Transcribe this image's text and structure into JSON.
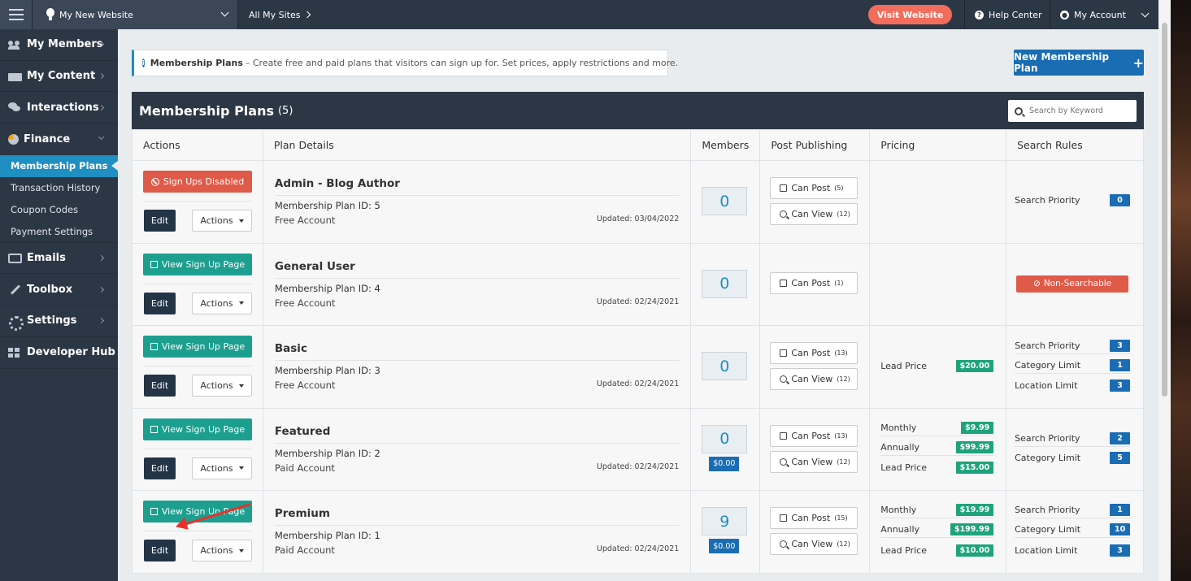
{
  "topbar": {
    "site_name": "My New Website",
    "all_sites": "All My Sites",
    "visit": "Visit Website",
    "help": "Help Center",
    "account": "My Account"
  },
  "sidebar": {
    "items": [
      {
        "label": "My Members",
        "icon": "members-icon"
      },
      {
        "label": "My Content",
        "icon": "folder-icon"
      },
      {
        "label": "Interactions",
        "icon": "chat-icon"
      },
      {
        "label": "Finance",
        "icon": "pie-chart-icon"
      }
    ],
    "finance_sub": [
      "Membership Plans",
      "Transaction History",
      "Coupon Codes",
      "Payment Settings"
    ],
    "items2": [
      {
        "label": "Emails",
        "icon": "inbox-icon"
      },
      {
        "label": "Toolbox",
        "icon": "wrench-icon"
      },
      {
        "label": "Settings",
        "icon": "gear-icon"
      },
      {
        "label": "Developer Hub",
        "icon": "grid-icon"
      }
    ]
  },
  "info": {
    "title": "Membership Plans",
    "text": "– Create free and paid plans that visitors can sign up for. Set prices, apply restrictions and more."
  },
  "new_plan": "New Membership Plan",
  "panel": {
    "title": "Membership Plans",
    "count": "(5)",
    "search_placeholder": "Search by Keyword"
  },
  "columns": [
    "Actions",
    "Plan Details",
    "Members",
    "Post Publishing",
    "Pricing",
    "Search Rules"
  ],
  "edit": "Edit",
  "actions": "Actions",
  "can_post": "Can Post",
  "can_view": "Can View",
  "plans": [
    {
      "action": "Sign Ups Disabled",
      "name": "Admin - Blog Author",
      "id_label": "Membership Plan ID:",
      "id": "5",
      "account": "Free Account",
      "updated": "Updated: 03/04/2022",
      "members": "0",
      "post_count": "(5)",
      "view_count": "(12)",
      "search": [
        {
          "label": "Search Priority",
          "value": "0"
        }
      ]
    },
    {
      "action": "View Sign Up Page",
      "name": "General User",
      "id_label": "Membership Plan ID:",
      "id": "4",
      "account": "Free Account",
      "updated": "Updated: 02/24/2021",
      "members": "0",
      "post_count": "(1)",
      "non_search": "Non-Searchable"
    },
    {
      "action": "View Sign Up Page",
      "name": "Basic",
      "id_label": "Membership Plan ID:",
      "id": "3",
      "account": "Free Account",
      "updated": "Updated: 02/24/2021",
      "members": "0",
      "post_count": "(13)",
      "view_count": "(12)",
      "pricing": [
        {
          "label": "Lead Price",
          "value": "$20.00"
        }
      ],
      "search": [
        {
          "label": "Search Priority",
          "value": "3"
        },
        {
          "label": "Category Limit",
          "value": "1"
        },
        {
          "label": "Location Limit",
          "value": "3"
        }
      ]
    },
    {
      "action": "View Sign Up Page",
      "name": "Featured",
      "id_label": "Membership Plan ID:",
      "id": "2",
      "account": "Paid Account",
      "updated": "Updated: 02/24/2021",
      "members": "0",
      "member_price": "$0.00",
      "post_count": "(13)",
      "view_count": "(12)",
      "pricing": [
        {
          "label": "Monthly",
          "value": "$9.99"
        },
        {
          "label": "Annually",
          "value": "$99.99"
        },
        {
          "label": "Lead Price",
          "value": "$15.00"
        }
      ],
      "search": [
        {
          "label": "Search Priority",
          "value": "2"
        },
        {
          "label": "Category Limit",
          "value": "5"
        }
      ]
    },
    {
      "action": "View Sign Up Page",
      "name": "Premium",
      "id_label": "Membership Plan ID:",
      "id": "1",
      "account": "Paid Account",
      "updated": "Updated: 02/24/2021",
      "members": "9",
      "member_price": "$0.00",
      "post_count": "(15)",
      "view_count": "(12)",
      "pricing": [
        {
          "label": "Monthly",
          "value": "$19.99"
        },
        {
          "label": "Annually",
          "value": "$199.99"
        },
        {
          "label": "Lead Price",
          "value": "$10.00"
        }
      ],
      "search": [
        {
          "label": "Search Priority",
          "value": "1"
        },
        {
          "label": "Category Limit",
          "value": "10"
        },
        {
          "label": "Location Limit",
          "value": "3"
        }
      ]
    }
  ],
  "colors": {
    "nav": "#2c3745",
    "accent": "#1f8fc1",
    "teal": "#1d9f90",
    "red": "#e05a4a",
    "green": "#1fa37a",
    "blue": "#1a6cb3"
  }
}
